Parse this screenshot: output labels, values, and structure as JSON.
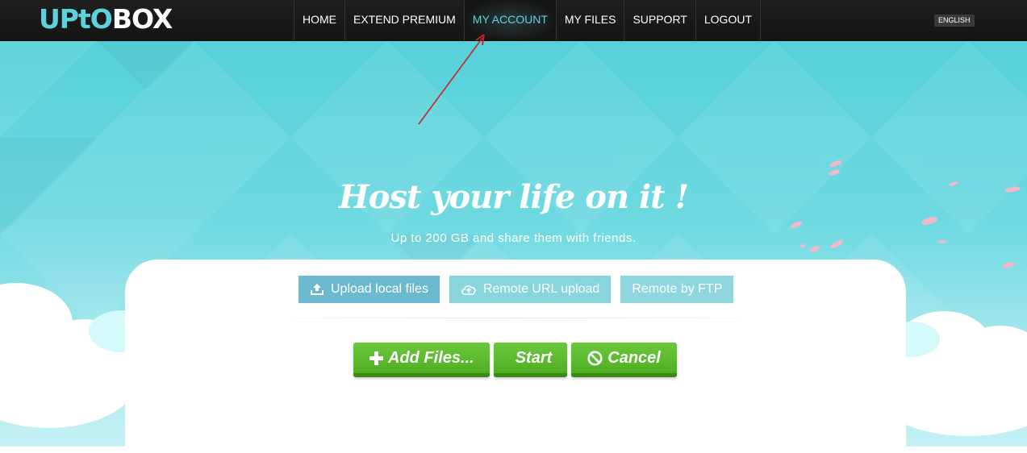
{
  "logo": {
    "part1": "UPtO",
    "part2": "BOX"
  },
  "nav": {
    "items": [
      "HOME",
      "EXTEND PREMIUM",
      "MY ACCOUNT",
      "MY FILES",
      "SUPPORT",
      "LOGOUT"
    ],
    "active": "MY ACCOUNT"
  },
  "language": "ENGLISH",
  "hero": {
    "title": "Host your life on it !",
    "subtitle": "Up to 200 GB and share them with friends."
  },
  "upload_tabs": {
    "local": "Upload local files",
    "remote_url": "Remote URL upload",
    "ftp": "Remote by FTP"
  },
  "actions": {
    "add_files": "Add Files...",
    "start": "Start",
    "cancel": "Cancel"
  },
  "colors": {
    "accent": "#5ed2dc",
    "hero_bg": "#56d1da",
    "button_green": "#5cbf2a",
    "annotation_arrow": "#cc2222"
  }
}
